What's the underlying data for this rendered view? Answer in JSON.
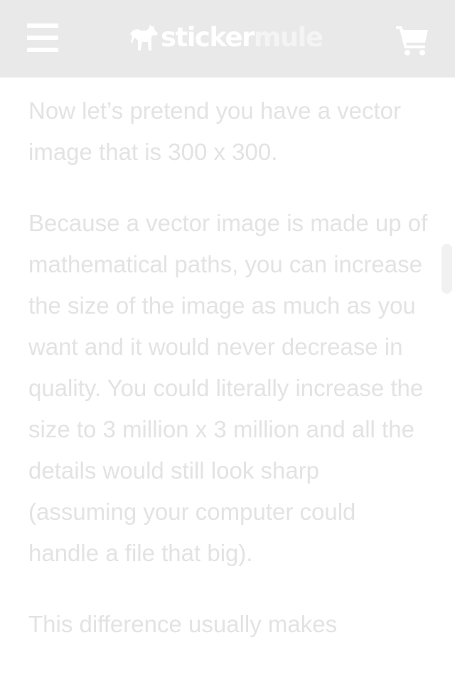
{
  "header": {
    "logo": {
      "word_primary": "sticker",
      "word_secondary": "mule"
    },
    "menu_icon": "hamburger-menu-icon",
    "cart_icon": "shopping-cart-icon"
  },
  "article": {
    "paragraphs": [
      "Now let’s pretend you have a vector image that is 300 x 300.",
      "Because a vector image is made up of mathematical paths, you can increase the size of the image as much as you want and it would never decrease in quality. You could literally increase the size to 3 million x 3 million and all the details would still look sharp (assuming your computer could handle a file that big).",
      "This difference usually makes"
    ]
  },
  "colors": {
    "header_bg": "#e9e9e9",
    "header_icons": "#ffffff",
    "body_text": "#e3e3e3",
    "page_bg": "#ffffff"
  }
}
